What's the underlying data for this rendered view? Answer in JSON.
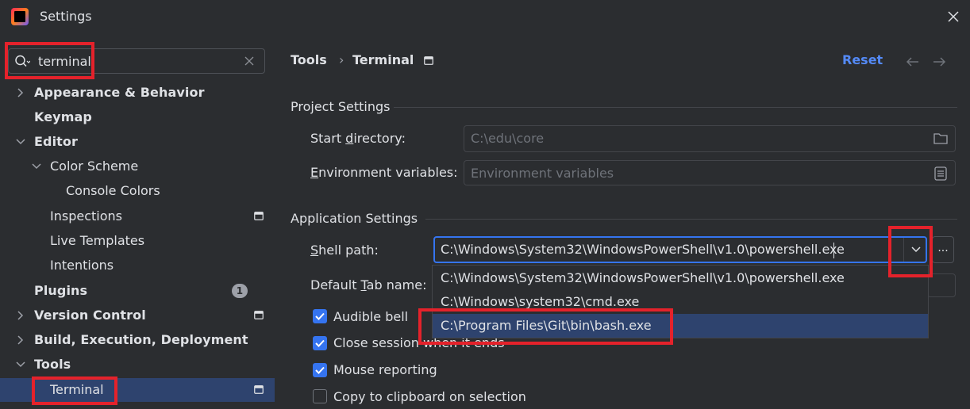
{
  "window": {
    "title": "Settings"
  },
  "search": {
    "value": "terminal"
  },
  "tree": {
    "appearance": "Appearance & Behavior",
    "keymap": "Keymap",
    "editor": "Editor",
    "color_scheme": "Color Scheme",
    "console_colors": "Console Colors",
    "inspections": "Inspections",
    "live_templates": "Live Templates",
    "intentions": "Intentions",
    "plugins": "Plugins",
    "plugins_badge": "1",
    "version_control": "Version Control",
    "build": "Build, Execution, Deployment",
    "tools": "Tools",
    "terminal": "Terminal"
  },
  "breadcrumb": {
    "parent": "Tools",
    "separator": "›",
    "current": "Terminal"
  },
  "header": {
    "reset_label": "Reset"
  },
  "project_settings": {
    "section_title": "Project Settings",
    "start_directory_label": "Start directory:",
    "start_directory_value": "C:\\edu\\core",
    "env_vars_label": "Environment variables:",
    "env_vars_placeholder": "Environment variables"
  },
  "app_settings": {
    "section_title": "Application Settings",
    "shell_path_label": "Shell path:",
    "shell_path_value": "C:\\Windows\\System32\\WindowsPowerShell\\v1.0\\powershell.exe",
    "default_tab_name_label": "Default Tab name:",
    "browse_label": "...",
    "shell_options": [
      "C:\\Windows\\System32\\WindowsPowerShell\\v1.0\\powershell.exe",
      "C:\\Windows\\system32\\cmd.exe",
      "C:\\Program Files\\Git\\bin\\bash.exe"
    ],
    "checkboxes": [
      {
        "label": "Audible bell",
        "checked": true
      },
      {
        "label": "Close session when it ends",
        "checked": true
      },
      {
        "label": "Mouse reporting",
        "checked": true
      },
      {
        "label": "Copy to clipboard on selection",
        "checked": false
      }
    ]
  },
  "colors": {
    "background": "#2b2d30",
    "accent": "#3574f0",
    "selection": "#2e436e",
    "link": "#548af7",
    "highlight": "#e4222b"
  }
}
